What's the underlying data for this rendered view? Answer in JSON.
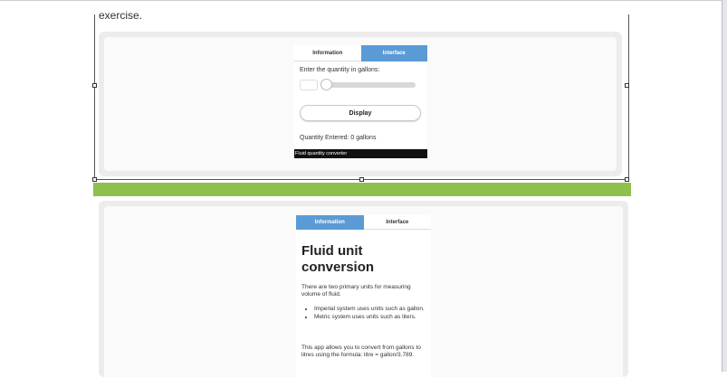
{
  "document": {
    "exercise_text": "exercise."
  },
  "app_interface_screenshot": {
    "tabs": [
      {
        "label": "Information",
        "active": false
      },
      {
        "label": "Interface",
        "active": true
      }
    ],
    "quantity_label": "Enter the quantity in gallons:",
    "slider_value": 0,
    "display_button": "Display",
    "result_text": "Quantity Entered: 0 gallons",
    "footer_title": "Fluid quantity converter"
  },
  "app_information_screenshot": {
    "tabs": [
      {
        "label": "Information",
        "active": true
      },
      {
        "label": "Interface",
        "active": false
      }
    ],
    "heading": "Fluid unit conversion",
    "intro": "There are two primary units for measuring volume of fluid.",
    "bullets": [
      "Imperial system uses units such as gallon.",
      "Metric system uses units such as liters."
    ],
    "formula_text": "This app allows you to convert from gallons to litres using the formula: litre = gallon/3.789."
  },
  "colors": {
    "tab_active": "#5b9bd5",
    "separator_bar": "#8fc04e",
    "footer_bg": "#111111"
  }
}
